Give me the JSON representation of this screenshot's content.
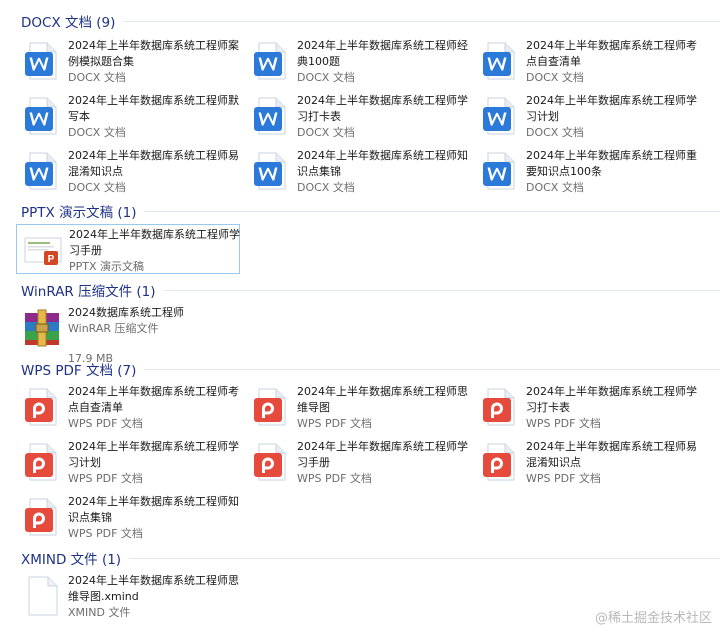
{
  "groups": [
    {
      "title": "DOCX 文档 (9)",
      "kind": "docx",
      "items": [
        {
          "name": "2024年上半年数据库系统工程师案例模拟题合集",
          "type": "DOCX 文档"
        },
        {
          "name": "2024年上半年数据库系统工程师经典100题",
          "type": "DOCX 文档"
        },
        {
          "name": "2024年上半年数据库系统工程师考点自查清单",
          "type": "DOCX 文档"
        },
        {
          "name": "2024年上半年数据库系统工程师默写本",
          "type": "DOCX 文档"
        },
        {
          "name": "2024年上半年数据库系统工程师学习打卡表",
          "type": "DOCX 文档"
        },
        {
          "name": "2024年上半年数据库系统工程师学习计划",
          "type": "DOCX 文档"
        },
        {
          "name": "2024年上半年数据库系统工程师易混淆知识点",
          "type": "DOCX 文档"
        },
        {
          "name": "2024年上半年数据库系统工程师知识点集锦",
          "type": "DOCX 文档"
        },
        {
          "name": "2024年上半年数据库系统工程师重要知识点100条",
          "type": "DOCX 文档"
        }
      ]
    },
    {
      "title": "PPTX 演示文稿 (1)",
      "kind": "pptx",
      "items": [
        {
          "name": "2024年上半年数据库系统工程师学习手册",
          "type": "PPTX 演示文稿"
        }
      ]
    },
    {
      "title": "WinRAR 压缩文件 (1)",
      "kind": "rar",
      "items": [
        {
          "name": "2024数据库系统工程师",
          "type": "WinRAR 压缩文件",
          "size": "17.9 MB"
        }
      ]
    },
    {
      "title": "WPS PDF 文档 (7)",
      "kind": "pdf",
      "items": [
        {
          "name": "2024年上半年数据库系统工程师考点自查清单",
          "type": "WPS PDF 文档"
        },
        {
          "name": "2024年上半年数据库系统工程师思维导图",
          "type": "WPS PDF 文档"
        },
        {
          "name": "2024年上半年数据库系统工程师学习打卡表",
          "type": "WPS PDF 文档"
        },
        {
          "name": "2024年上半年数据库系统工程师学习计划",
          "type": "WPS PDF 文档"
        },
        {
          "name": "2024年上半年数据库系统工程师学习手册",
          "type": "WPS PDF 文档"
        },
        {
          "name": "2024年上半年数据库系统工程师易混淆知识点",
          "type": "WPS PDF 文档"
        },
        {
          "name": "2024年上半年数据库系统工程师知识点集锦",
          "type": "WPS PDF 文档"
        }
      ]
    },
    {
      "title": "XMIND 文件 (1)",
      "kind": "xmind",
      "items": [
        {
          "name": "2024年上半年数据库系统工程师思维导图.xmind",
          "type": "XMIND 文件"
        }
      ]
    }
  ],
  "watermark": "@稀土掘金技术社区",
  "colors": {
    "group_title": "#1e3287",
    "docx_icon": "#2b79d8",
    "pdf_icon": "#e64a3c",
    "pptx_icon": "#d24726",
    "selection_border": "#99c9ef"
  }
}
